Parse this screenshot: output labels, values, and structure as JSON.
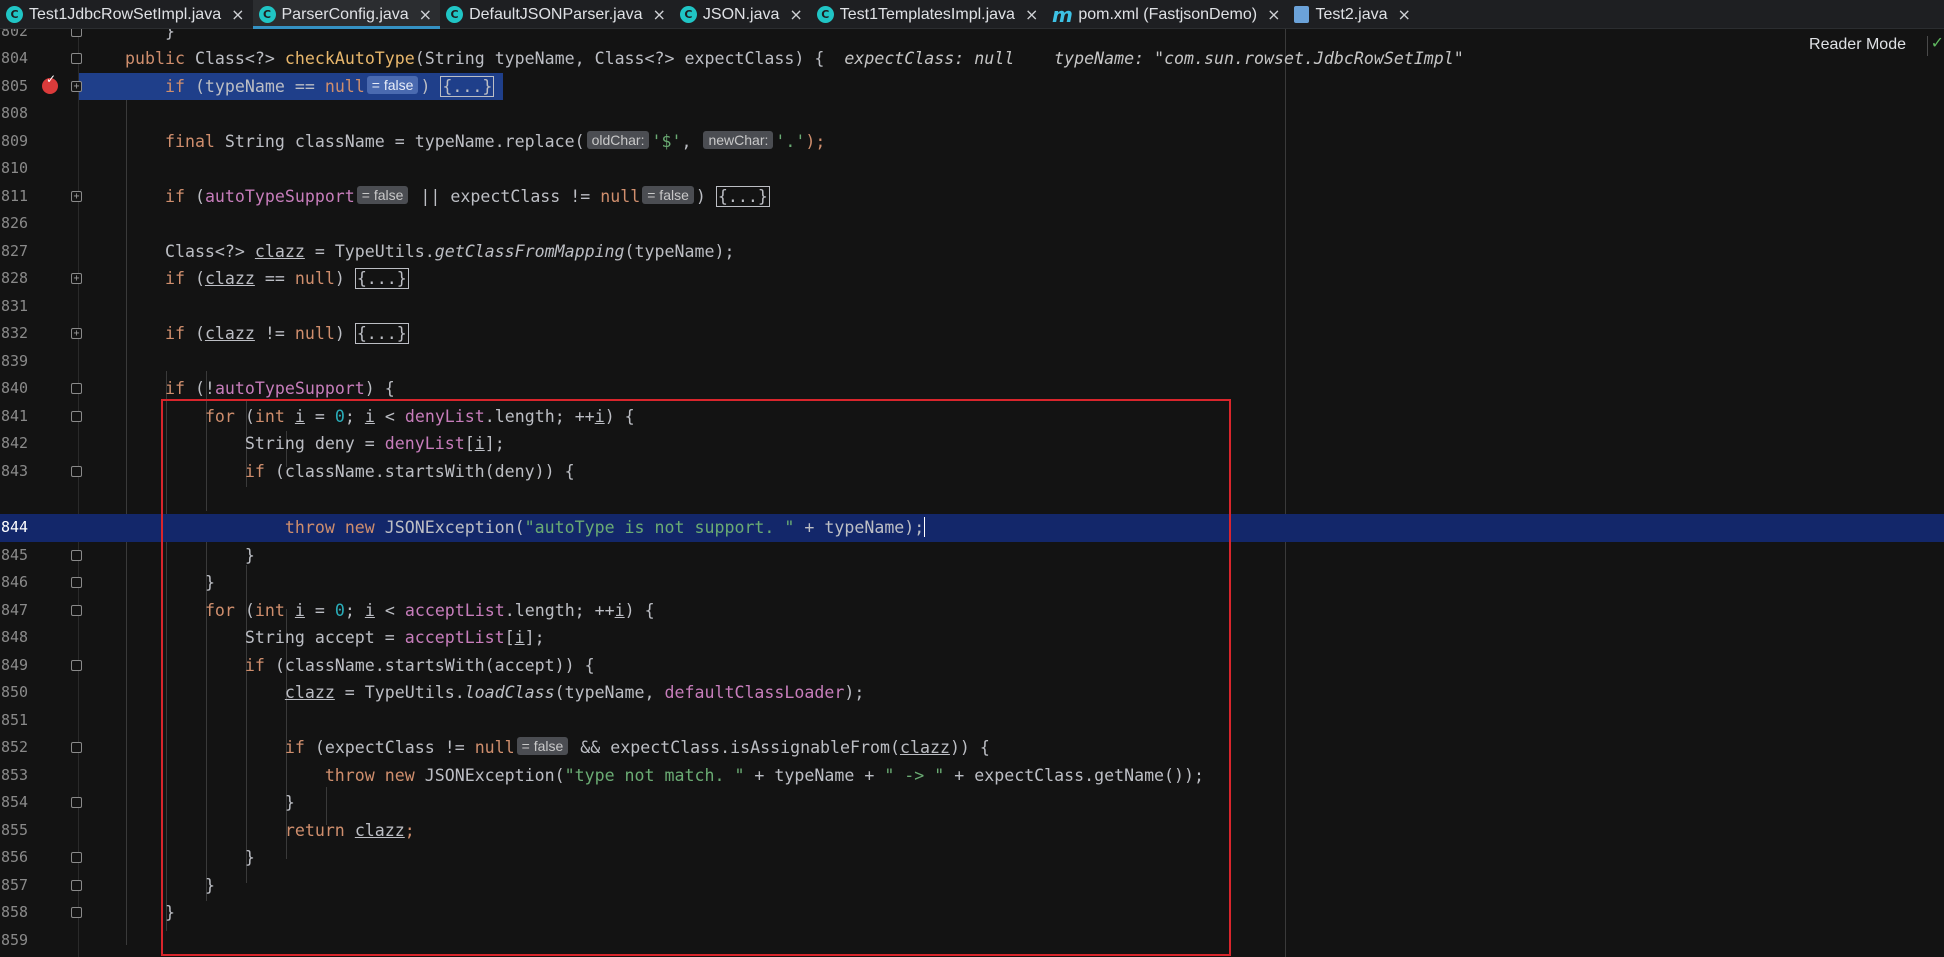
{
  "tabs": [
    {
      "label": "Test1JdbcRowSetImpl.java",
      "icon": "class-icon",
      "active": false
    },
    {
      "label": "ParserConfig.java",
      "icon": "class-icon",
      "active": true
    },
    {
      "label": "DefaultJSONParser.java",
      "icon": "class-icon",
      "active": false
    },
    {
      "label": "JSON.java",
      "icon": "class-icon",
      "active": false
    },
    {
      "label": "Test1TemplatesImpl.java",
      "icon": "class-icon",
      "active": false
    },
    {
      "label": "pom.xml (FastjsonDemo)",
      "icon": "maven-icon",
      "active": false
    },
    {
      "label": "Test2.java",
      "icon": "java-file-icon",
      "active": false
    }
  ],
  "close_glyph": "×",
  "reader_mode": "Reader Mode",
  "fold_collapsed": "{...}",
  "line_numbers": [
    "802",
    "804",
    "805",
    "808",
    "809",
    "810",
    "811",
    "826",
    "827",
    "828",
    "831",
    "832",
    "839",
    "840",
    "841",
    "842",
    "843",
    "844",
    "845",
    "846",
    "847",
    "848",
    "849",
    "850",
    "851",
    "852",
    "853",
    "854",
    "855",
    "856",
    "857",
    "858",
    "859"
  ],
  "code": {
    "l802": "}",
    "l804_kw": "public",
    "l804_type": "Class<?>",
    "l804_name": "checkAutoType",
    "l804_params": "(String typeName, Class<?> expectClass) {",
    "l804_hint1": "expectClass: null",
    "l804_hint2": "typeName: \"com.sun.rowset.JdbcRowSetImpl\"",
    "l805_kw": "if",
    "l805_a": " (typeName == ",
    "l805_null": "null",
    "l805_hint": "= false",
    "l805_b": ") ",
    "l809_kw": "final",
    "l809_a": " String className = typeName.replace(",
    "l809_hint1": "oldChar:",
    "l809_s1": "'$'",
    "l809_comma": ", ",
    "l809_hint2": "newChar:",
    "l809_s2": "'.'",
    "l809_end": ");",
    "l811_kw": "if",
    "l811_a": " (",
    "l811_field": "autoTypeSupport",
    "l811_hint1": "= false",
    "l811_b": " || expectClass != ",
    "l811_null": "null",
    "l811_hint2": "= false",
    "l811_c": ") ",
    "l826_a": "Class<?> ",
    "l826_var": "clazz",
    "l826_b": " = TypeUtils.",
    "l826_m": "getClassFromMapping",
    "l826_c": "(typeName);",
    "l827_kw": "if",
    "l827_a": " (",
    "l827_var": "clazz",
    "l827_b": " == ",
    "l827_null": "null",
    "l827_c": ") ",
    "l831_kw": "if",
    "l831_a": " (",
    "l831_var": "clazz",
    "l831_b": " != ",
    "l831_null": "null",
    "l831_c": ") ",
    "l840_kw": "if",
    "l840_a": " (!",
    "l840_field": "autoTypeSupport",
    "l840_b": ") {",
    "l841_kw": "for",
    "l841_a": " (",
    "l841_int": "int",
    "l841_i1": "i",
    "l841_b": " = ",
    "l841_zero": "0",
    "l841_c": "; ",
    "l841_i2": "i",
    "l841_d": " < ",
    "l841_field": "denyList",
    "l841_e": ".length; ++",
    "l841_i3": "i",
    "l841_f": ") {",
    "l842_a": "String deny = ",
    "l842_field": "denyList",
    "l842_b": "[",
    "l842_i": "i",
    "l842_c": "];",
    "l843_kw": "if",
    "l843_a": " (className.startsWith(deny)) {",
    "l844_kw1": "throw",
    "l844_kw2": "new",
    "l844_a": " JSONException(",
    "l844_str": "\"autoType is not support. \"",
    "l844_b": " + typeName);",
    "l845": "}",
    "l846": "}",
    "l847_kw": "for",
    "l847_a": " (",
    "l847_int": "int",
    "l847_i1": "i",
    "l847_b": " = ",
    "l847_zero": "0",
    "l847_c": "; ",
    "l847_i2": "i",
    "l847_d": " < ",
    "l847_field": "acceptList",
    "l847_e": ".length; ++",
    "l847_i3": "i",
    "l847_f": ") {",
    "l848_a": "String accept = ",
    "l848_field": "acceptList",
    "l848_b": "[",
    "l848_i": "i",
    "l848_c": "];",
    "l849_kw": "if",
    "l849_a": " (className.startsWith(accept)) {",
    "l850_var": "clazz",
    "l850_a": " = TypeUtils.",
    "l850_m": "loadClass",
    "l850_b": "(typeName, ",
    "l850_field": "defaultClassLoader",
    "l850_c": ");",
    "l852_kw": "if",
    "l852_a": " (expectClass != ",
    "l852_null": "null",
    "l852_hint": "= false",
    "l852_b": " && expectClass.isAssignableFrom(",
    "l852_var": "clazz",
    "l852_c": ")) {",
    "l853_kw1": "throw",
    "l853_kw2": "new",
    "l853_a": " JSONException(",
    "l853_str1": "\"type not match. \"",
    "l853_b": " + typeName + ",
    "l853_str2": "\" -> \"",
    "l853_c": " + expectClass.getName());",
    "l854": "}",
    "l855_kw": "return",
    "l855_var": "clazz",
    "l855_a": ";",
    "l856": "}",
    "l857": "}",
    "l858": "}"
  }
}
